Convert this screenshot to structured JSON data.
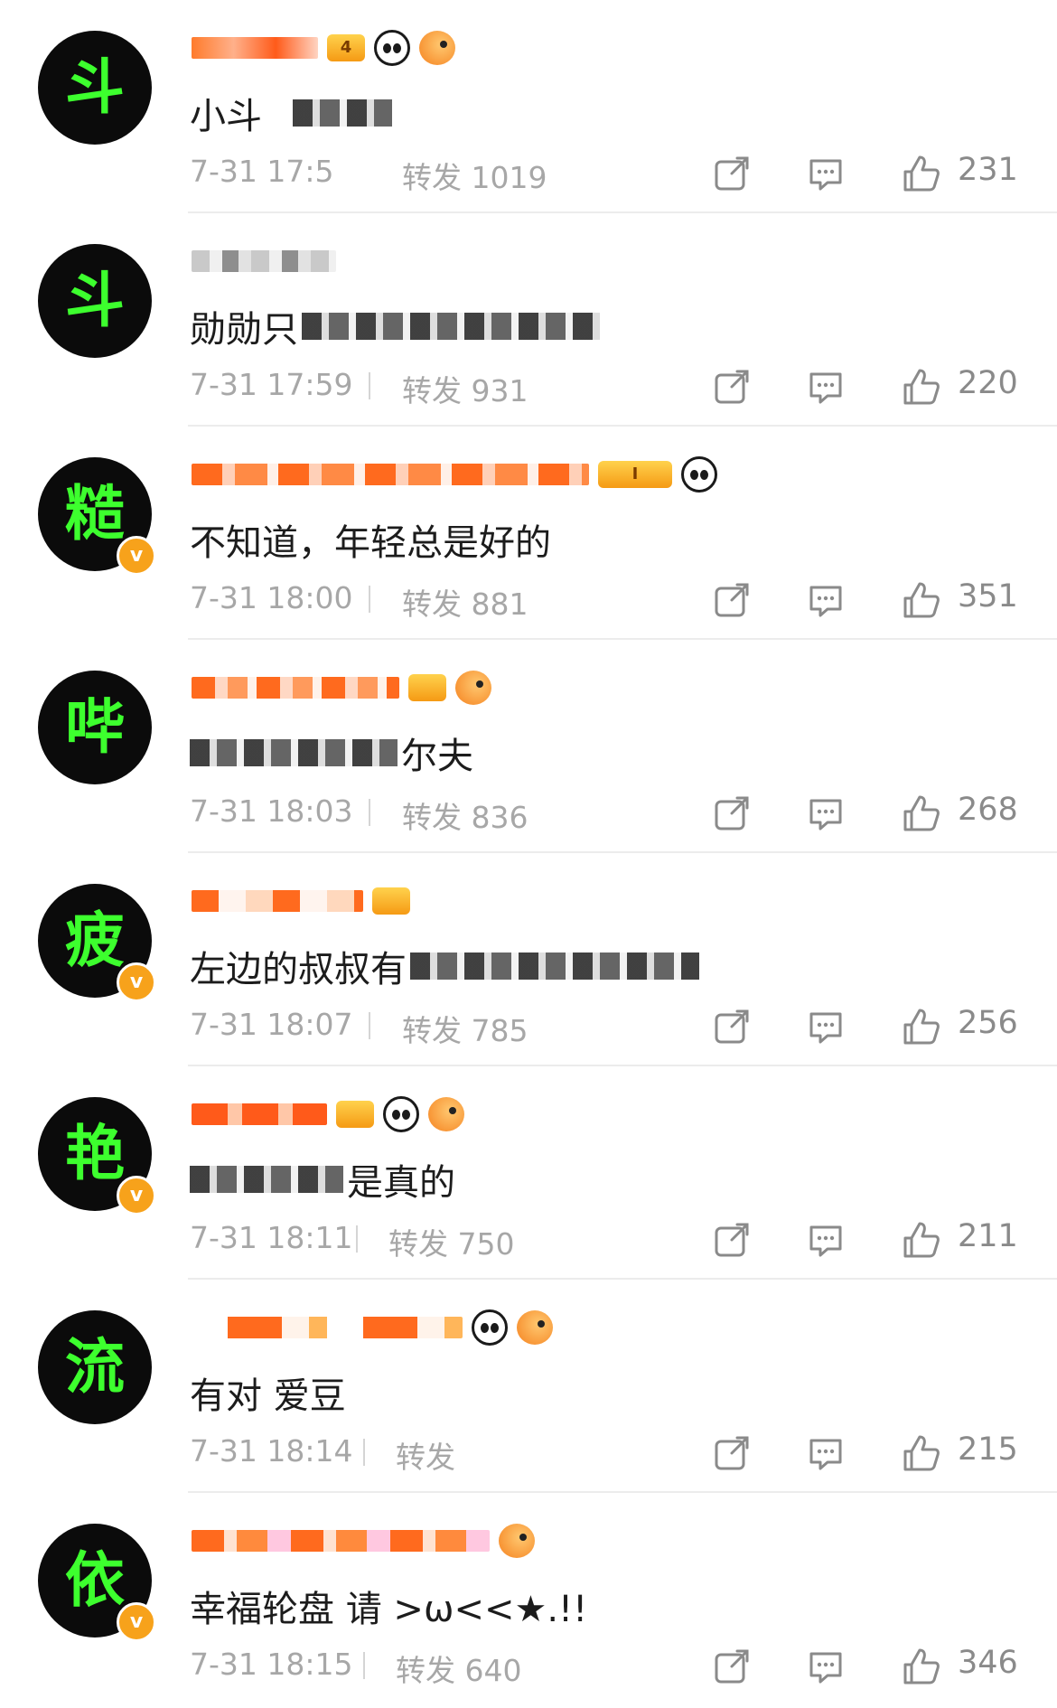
{
  "labels": {
    "repost_prefix": "转发"
  },
  "colors": {
    "avatar_bg": "#0b0b0b",
    "avatar_text": "#3dff2e",
    "verified_badge": "#f7a21b",
    "meta_text": "#a7a7a7"
  },
  "comments": [
    {
      "avatar_char": "斗",
      "verified": false,
      "badges": [
        "level-badge",
        "panda-icon",
        "fish-icon"
      ],
      "level_text": "4",
      "text": "小斗",
      "time": "7-31 17:5",
      "repost_label": "转发 1019",
      "likes": "231"
    },
    {
      "avatar_char": "斗",
      "verified": false,
      "badges": [],
      "level_text": "",
      "text": "勋勋只",
      "time": "7-31 17:59",
      "repost_label": "转发 931",
      "likes": "220"
    },
    {
      "avatar_char": "糙",
      "verified": true,
      "badges": [
        "crown-badge",
        "panda-icon"
      ],
      "level_text": "I",
      "text": "不知道，年轻总是好的",
      "time": "7-31 18:00",
      "repost_label": "转发 881",
      "likes": "351"
    },
    {
      "avatar_char": "哔",
      "verified": false,
      "badges": [
        "crown-badge",
        "fish-icon"
      ],
      "level_text": "",
      "text": "尔夫",
      "time": "7-31 18:03",
      "repost_label": "转发 836",
      "likes": "268"
    },
    {
      "avatar_char": "疲",
      "verified": true,
      "badges": [
        "crown-badge"
      ],
      "level_text": "",
      "text": "左边的叔叔有",
      "time": "7-31 18:07",
      "repost_label": "转发 785",
      "likes": "256"
    },
    {
      "avatar_char": "艳",
      "verified": true,
      "badges": [
        "crown-badge",
        "panda-icon",
        "fish-icon"
      ],
      "level_text": "",
      "text": "是真的",
      "time": "7-31 18:11",
      "repost_label": "转发 750",
      "likes": "211"
    },
    {
      "avatar_char": "流",
      "verified": false,
      "badges": [
        "panda-icon",
        "fish-icon"
      ],
      "level_text": "",
      "text": "有对 爱豆",
      "time": "7-31 18:14",
      "repost_label": "转发",
      "likes": "215"
    },
    {
      "avatar_char": "依",
      "verified": true,
      "badges": [
        "fish-icon"
      ],
      "level_text": "",
      "text": "幸福轮盘 请 >ω<<★.!!",
      "time": "7-31 18:15",
      "repost_label": "转发 640",
      "likes": "346"
    }
  ]
}
